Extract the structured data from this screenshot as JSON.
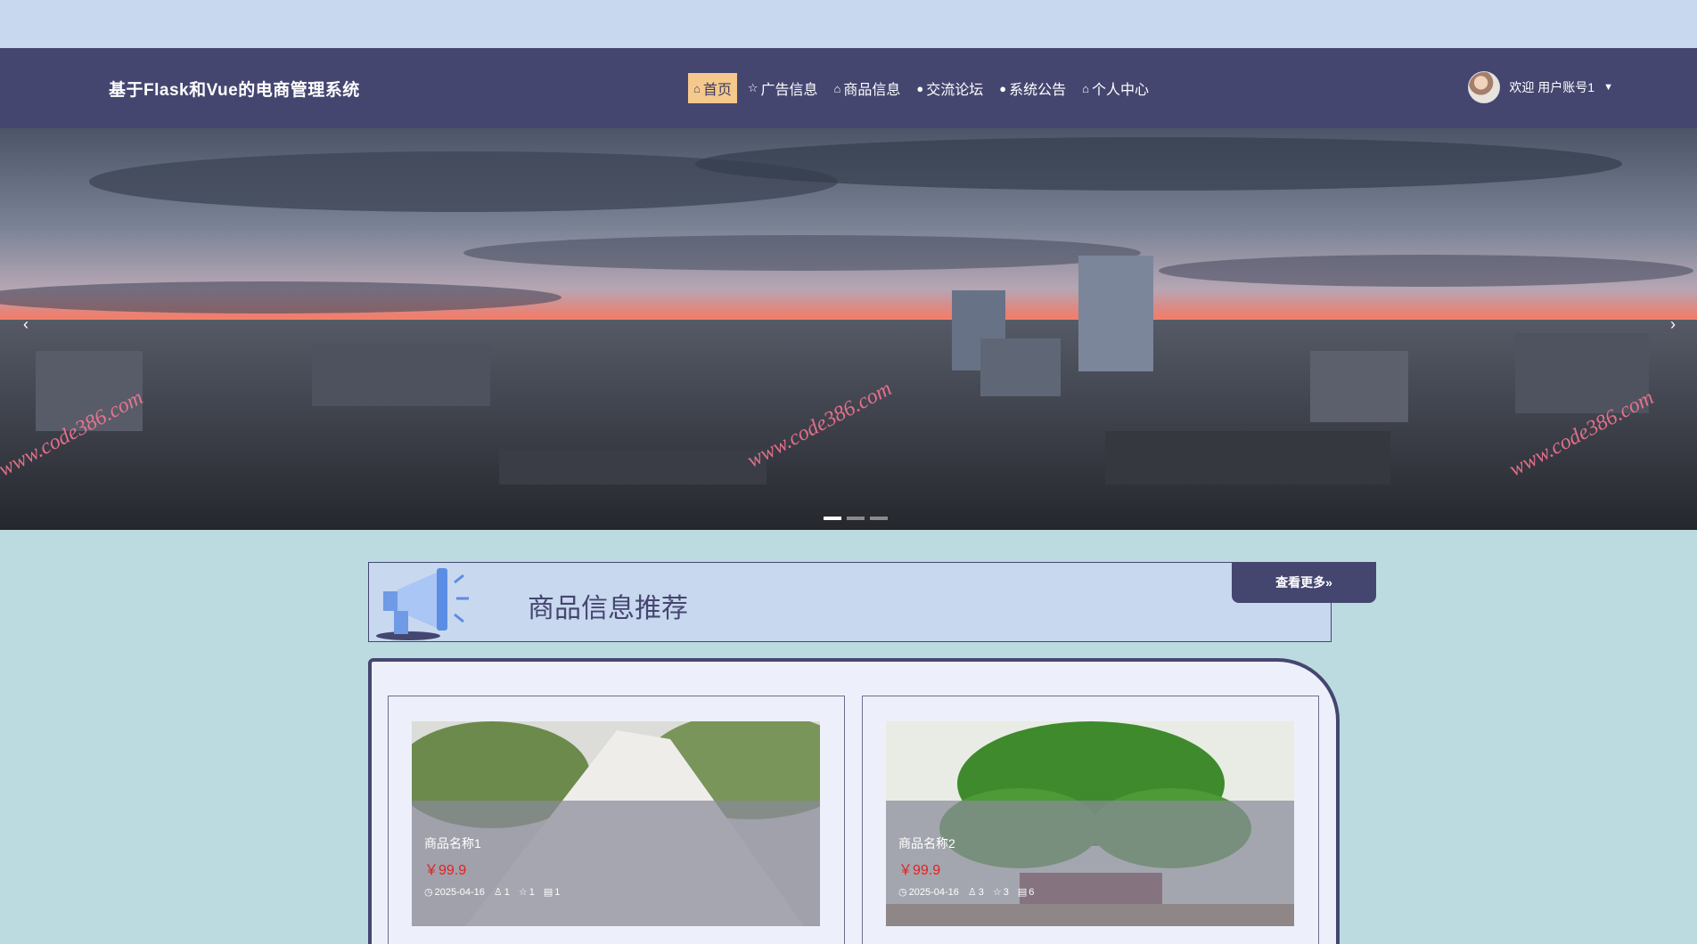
{
  "site": {
    "brand": "基于Flask和Vue的电商管理系统"
  },
  "nav": {
    "items": [
      {
        "label": "首页",
        "icon": "home-icon",
        "active": true
      },
      {
        "label": "广告信息",
        "icon": "star-icon",
        "active": false
      },
      {
        "label": "商品信息",
        "icon": "bag-icon",
        "active": false
      },
      {
        "label": "交流论坛",
        "icon": "info-icon",
        "active": false
      },
      {
        "label": "系统公告",
        "icon": "help-icon",
        "active": false
      },
      {
        "label": "个人中心",
        "icon": "home-icon",
        "active": false
      }
    ]
  },
  "user": {
    "greeting": "欢迎 用户账号1"
  },
  "carousel": {
    "prev": "‹",
    "next": "›",
    "watermark": "www.code386.com",
    "active_index": 0,
    "count": 3
  },
  "section": {
    "title": "商品信息推荐",
    "more_label": "查看更多»"
  },
  "products": [
    {
      "name": "商品名称1",
      "price": "￥99.9",
      "date": "2025-04-16",
      "likes": "1",
      "stars": "1",
      "comments": "1"
    },
    {
      "name": "商品名称2",
      "price": "￥99.9",
      "date": "2025-04-16",
      "likes": "3",
      "stars": "3",
      "comments": "6"
    }
  ],
  "colors": {
    "nav_bg": "#454670",
    "active_nav": "#f5c98c",
    "page_bg": "#bcdbe0",
    "price": "#e22222"
  }
}
